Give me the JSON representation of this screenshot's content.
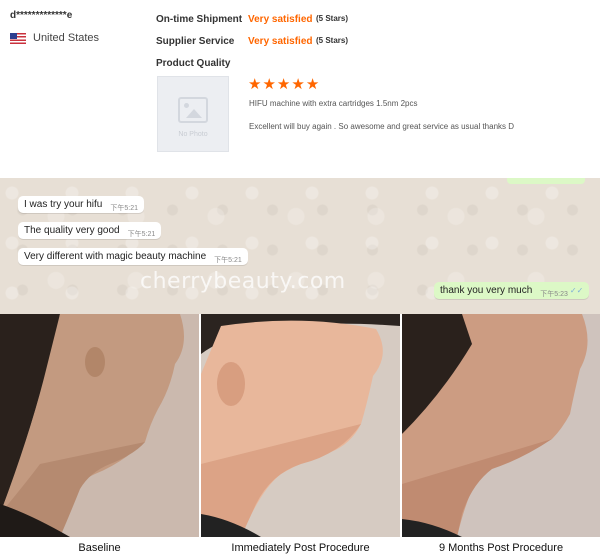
{
  "review": {
    "buyer_name": "d*************e",
    "country": "United States",
    "metrics": [
      {
        "label": "On-time Shipment",
        "value": "Very satisfied",
        "stars": "(5 Stars)"
      },
      {
        "label": "Supplier Service",
        "value": "Very satisfied",
        "stars": "(5 Stars)"
      },
      {
        "label": "Product Quality"
      }
    ],
    "photo_placeholder": "No Photo",
    "rating": 5,
    "product": "HIFU machine with extra cartridges 1.5nm 2pcs",
    "comment": "Excellent will buy again . So awesome and great service as usual thanks D",
    "accent": "#ff6600"
  },
  "chat": {
    "messages": [
      {
        "text": "I was try your hifu",
        "time": "下午5:21",
        "from": "them"
      },
      {
        "text": "The quality very good",
        "time": "下午5:21",
        "from": "them"
      },
      {
        "text": "Very different with magic beauty machine",
        "time": "下午5:21",
        "from": "them"
      },
      {
        "text": "thank you very much",
        "time": "下午5:23",
        "from": "me"
      }
    ],
    "watermark": "cherrybeauty.com"
  },
  "panels": [
    {
      "caption": "Baseline"
    },
    {
      "caption": "Immediately Post Procedure"
    },
    {
      "caption": "9 Months Post Procedure"
    }
  ]
}
